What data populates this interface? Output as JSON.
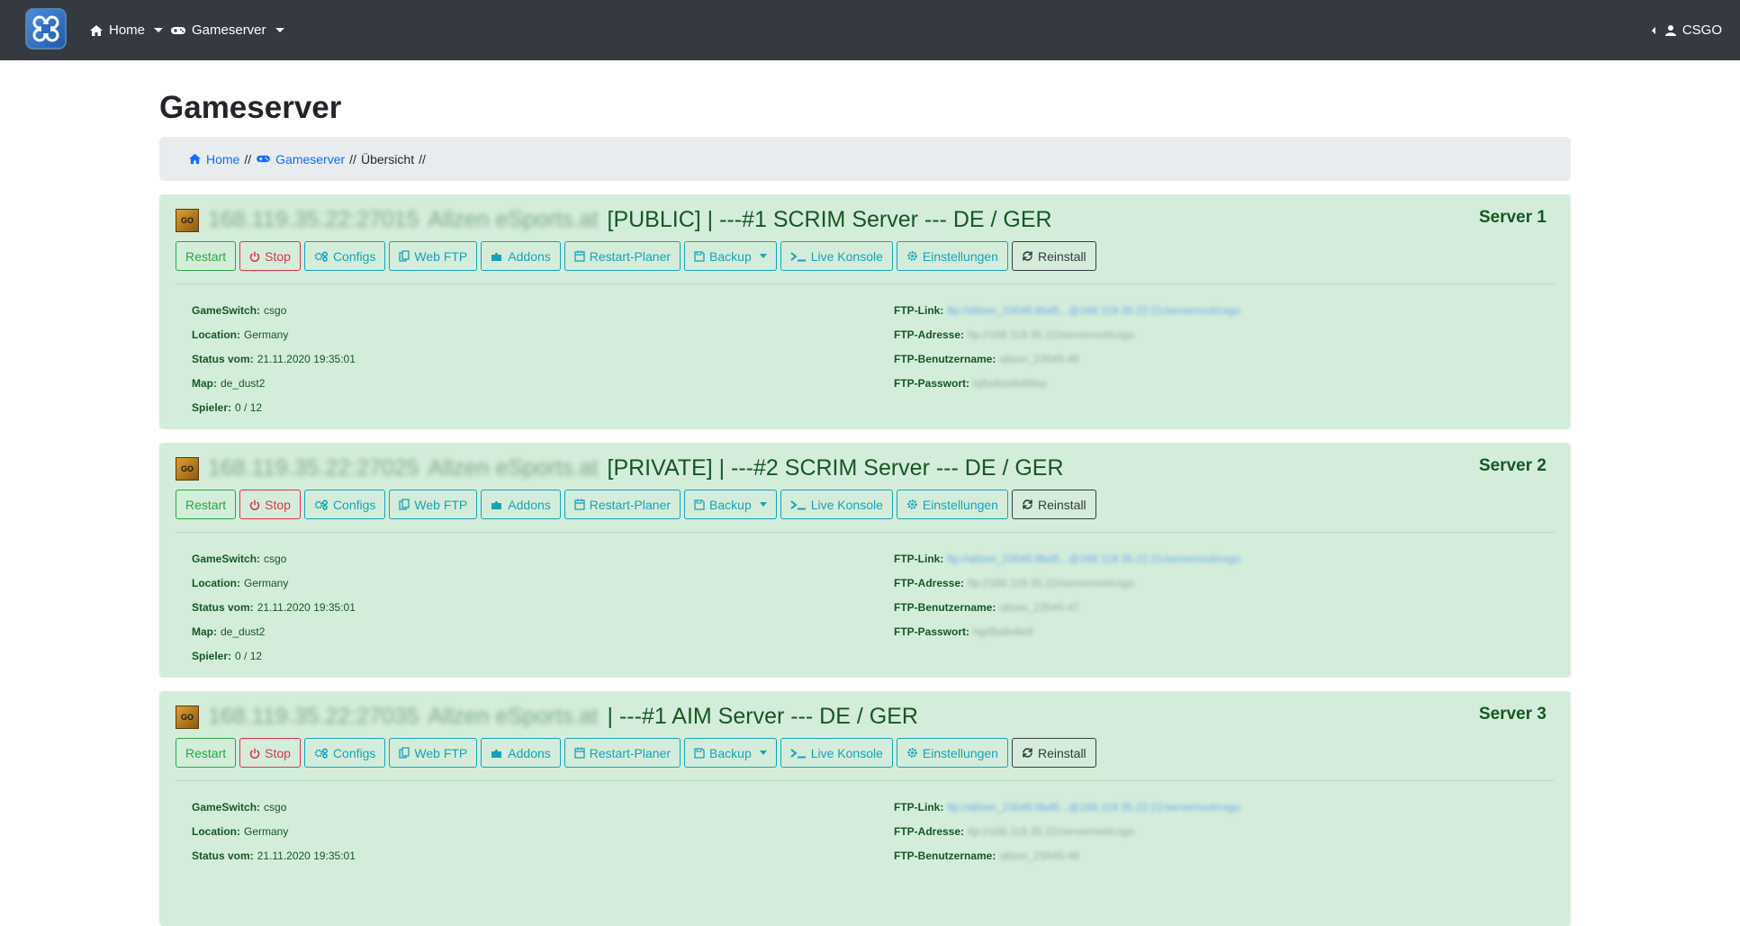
{
  "nav": {
    "home_label": "Home",
    "gameserver_label": "Gameserver",
    "user_label": "CSGO"
  },
  "page": {
    "title": "Gameserver"
  },
  "breadcrumb": {
    "home": "Home",
    "sep1": "//",
    "gameserver": "Gameserver",
    "sep2": "//",
    "current": "Übersicht",
    "sep3": "//"
  },
  "buttons": {
    "restart": "Restart",
    "stop": "Stop",
    "configs": "Configs",
    "webftp": "Web FTP",
    "addons": "Addons",
    "planer": "Restart-Planer",
    "backup": "Backup",
    "konsole": "Live Konsole",
    "einstellungen": "Einstellungen",
    "reinstall": "Reinstall"
  },
  "labels": {
    "gameswitch": "GameSwitch:",
    "location": "Location:",
    "status": "Status vom:",
    "map": "Map:",
    "spieler": "Spieler:",
    "ftp_link": "FTP-Link:",
    "ftp_adresse": "FTP-Adresse:",
    "ftp_user": "FTP-Benutzername:",
    "ftp_pass": "FTP-Passwort:"
  },
  "servers": [
    {
      "number": "Server 1",
      "ip_blurred": "168.119.35.22:27015",
      "org_blurred": "Allzen eSports.at",
      "title": "[PUBLIC] | ---#1 SCRIM Server --- DE / GER",
      "gameswitch": "csgo",
      "location": "Germany",
      "status": "21.11.2020 19:35:01",
      "map": "de_dust2",
      "spieler": "0 / 12",
      "ftp_link": "ftp://allzen_23045:8bd5...@168.119.35.22:21/serverroot/csgo",
      "ftp_adresse": "ftp://168.119.35.22/serverroot/csgo",
      "ftp_user": "allzen_23045-46",
      "ftp_pass": "lq5a4ce8e89np"
    },
    {
      "number": "Server 2",
      "ip_blurred": "168.119.35.22:27025",
      "org_blurred": "Allzen eSports.at",
      "title": "[PRIVATE] | ---#2 SCRIM Server --- DE / GER",
      "gameswitch": "csgo",
      "location": "Germany",
      "status": "21.11.2020 19:35:01",
      "map": "de_dust2",
      "spieler": "0 / 12",
      "ftp_link": "ftp://allzen_23045:8bd5...@168.119.35.22:21/serverroot/csgo",
      "ftp_adresse": "ftp://168.119.35.22/serverroot/csgo",
      "ftp_user": "allzen_23045-47",
      "ftp_pass": "hgd6a8e8e8"
    },
    {
      "number": "Server 3",
      "ip_blurred": "168.119.35.22:27035",
      "org_blurred": "Allzen eSports.at",
      "title": "| ---#1 AIM Server --- DE / GER",
      "gameswitch": "csgo",
      "location": "Germany",
      "status": "21.11.2020 19:35:01",
      "ftp_link": "ftp://allzen_23045:8bd5...@168.119.35.22:21/serverroot/csgo",
      "ftp_adresse": "ftp://168.119.35.22/serverroot/csgo",
      "ftp_user": "allzen_23045-48"
    }
  ],
  "colors": {
    "navbar": "#343a40",
    "card_bg": "#d4edda",
    "card_text": "#155724",
    "info": "#17a2b8",
    "success": "#28a745",
    "danger": "#dc3545",
    "link": "#0d6efd"
  }
}
